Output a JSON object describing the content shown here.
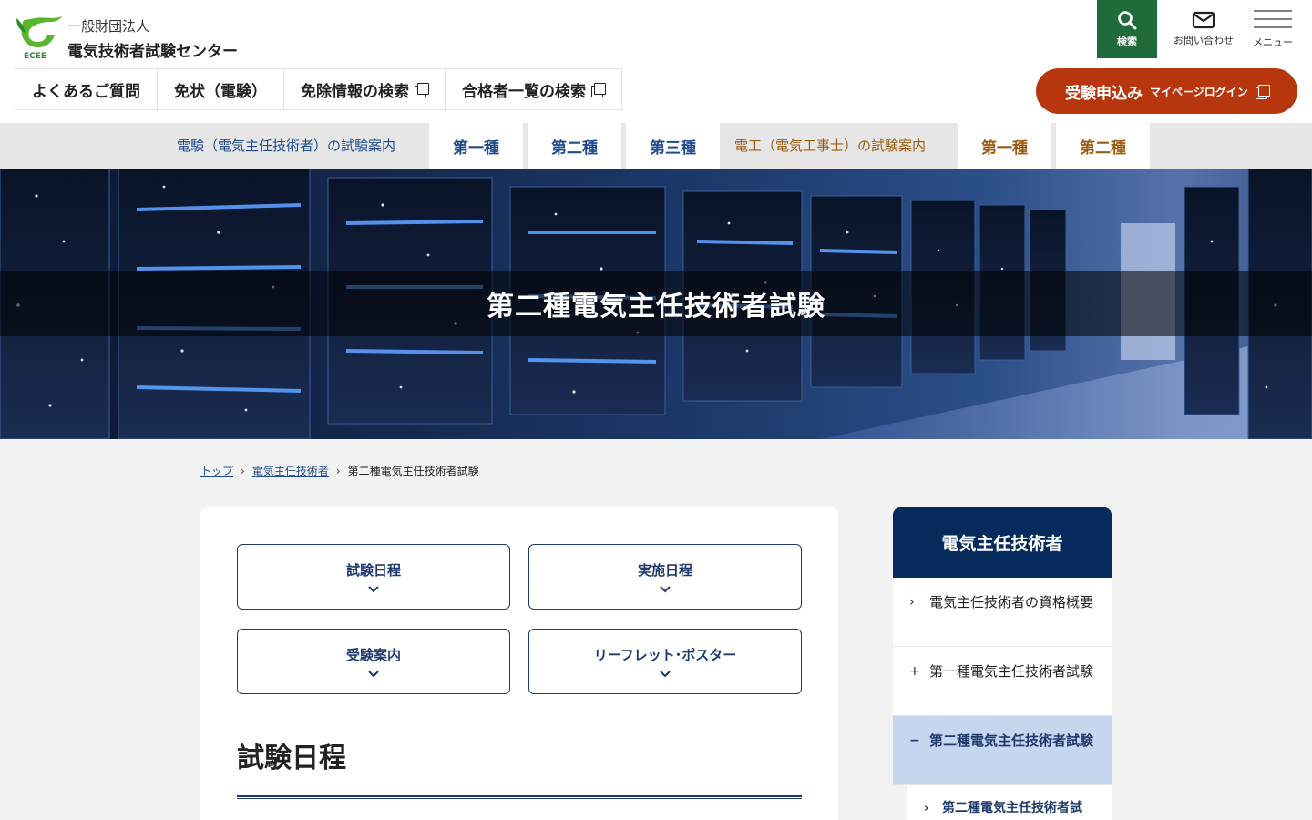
{
  "header": {
    "logo_text": "ECEE",
    "org_sub": "一般財団法人",
    "org_name": "電気技術者試験センター",
    "nav": [
      {
        "label": "よくあるご質問"
      },
      {
        "label": "免状（電験）"
      },
      {
        "label": "免除情報の検索"
      },
      {
        "label": "合格者一覧の検索"
      }
    ],
    "tools": {
      "search": "検索",
      "contact": "お問い合わせ",
      "menu": "メニュー"
    },
    "apply": {
      "main": "受験申込み",
      "sub": "マイページログイン"
    }
  },
  "category_nav": {
    "denken_label": "電験（電気主任技術者）の試験案内",
    "denken_tabs": [
      "第一種",
      "第二種",
      "第三種"
    ],
    "denko_label": "電工（電気工事士）の試験案内",
    "denko_tabs": [
      "第一種",
      "第二種"
    ]
  },
  "hero": {
    "title": "第二種電気主任技術者試験"
  },
  "breadcrumb": {
    "top": "トップ",
    "parent": "電気主任技術者",
    "current": "第二種電気主任技術者試験"
  },
  "main": {
    "anchors": [
      "試験日程",
      "実施日程",
      "受験案内",
      "リーフレット･ポスター"
    ],
    "section_title": "試験日程"
  },
  "sidebar": {
    "title": "電気主任技術者",
    "items": [
      {
        "mark": "›",
        "label": "電気主任技術者の資格概要"
      },
      {
        "mark": "+",
        "label": "第一種電気主任技術者試験"
      },
      {
        "mark": "−",
        "label": "第二種電気主任技術者試験"
      }
    ],
    "sub_item": {
      "mark": "›",
      "label": "第二種電気主任技術者試"
    }
  },
  "colors": {
    "brand_green": "#1f6b3a",
    "apply_red": "#b8360e",
    "navy": "#062a5c",
    "link_blue": "#1f4a8c"
  }
}
